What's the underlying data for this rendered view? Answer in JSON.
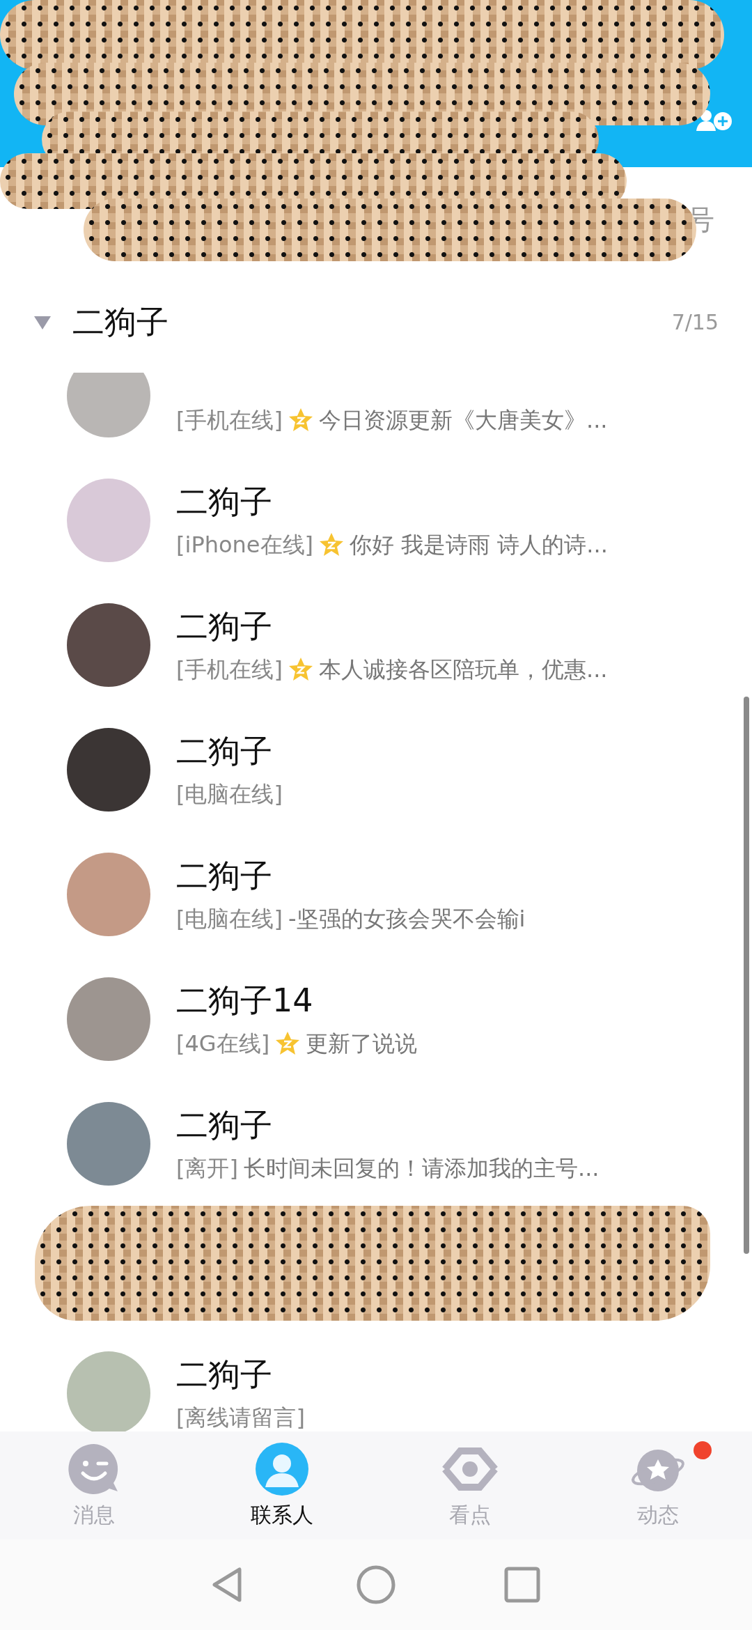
{
  "search_hint": "号",
  "group": {
    "name": "二狗子",
    "count": "7/15",
    "expanded": true
  },
  "contacts": [
    {
      "kind": "contact",
      "status": "[手机在线]",
      "star": true,
      "signature": "今日资源更新《大唐美女》..."
    },
    {
      "kind": "contact",
      "name": "二狗子",
      "status": "[iPhone在线]",
      "star": true,
      "signature": "你好 我是诗雨 诗人的诗..."
    },
    {
      "kind": "contact",
      "name": "二狗子",
      "status": "[手机在线]",
      "star": true,
      "signature": "本人诚接各区陪玩单，优惠..."
    },
    {
      "kind": "contact",
      "name": "二狗子",
      "status": "[电脑在线]",
      "star": false
    },
    {
      "kind": "contact",
      "name": "二狗子",
      "status": "[电脑在线]",
      "star": false,
      "signature": "-坚强的女孩会哭不会输i"
    },
    {
      "kind": "contact",
      "name": "二狗子14",
      "status": "[4G在线]",
      "star": true,
      "signature": "更新了说说"
    },
    {
      "kind": "contact",
      "name": "二狗子",
      "status": "[离开]",
      "star": false,
      "signature": "长时间未回复的！请添加我的主号..."
    },
    {
      "kind": "redacted"
    },
    {
      "kind": "contact",
      "name": "二狗子",
      "status": "[离线请留言]",
      "star": false
    }
  ],
  "tabs": [
    {
      "label": "消息",
      "kind": "chat",
      "selected": false,
      "badge": false
    },
    {
      "label": "联系人",
      "kind": "contacts",
      "selected": true,
      "badge": false
    },
    {
      "label": "看点",
      "kind": "eye",
      "selected": false,
      "badge": false
    },
    {
      "label": "动态",
      "kind": "planet",
      "selected": false,
      "badge": true
    }
  ]
}
